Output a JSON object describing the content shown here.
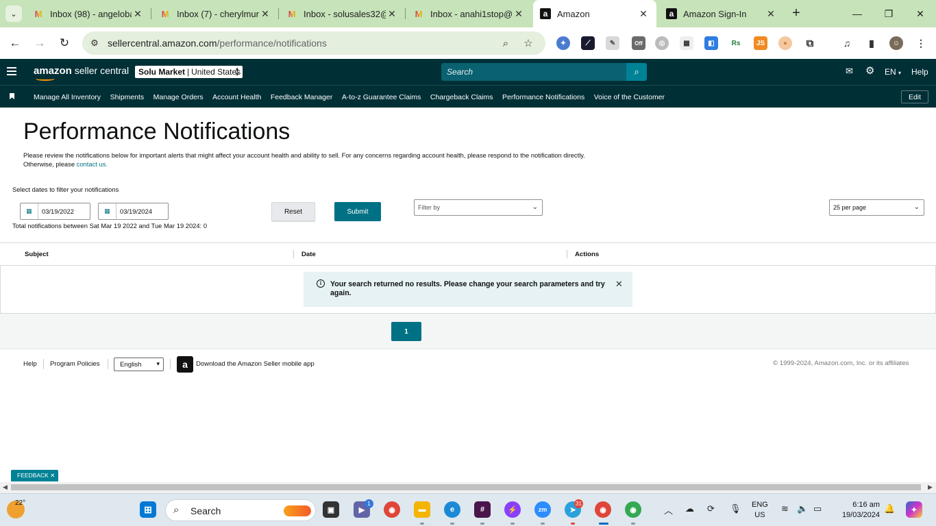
{
  "browser": {
    "tabs": [
      {
        "title": "Inbox (98) - angeloba",
        "icon": "gmail-icon"
      },
      {
        "title": "Inbox (7) - cherylmur",
        "icon": "gmail-icon"
      },
      {
        "title": "Inbox - solusales32@",
        "icon": "gmail-icon"
      },
      {
        "title": "Inbox - anahi1stop@",
        "icon": "gmail-icon"
      },
      {
        "title": "Amazon",
        "icon": "amazon-icon"
      },
      {
        "title": "Amazon Sign-In",
        "icon": "amazon-icon"
      }
    ],
    "url_host": "sellercentral.amazon.com",
    "url_path": "/performance/notifications",
    "extension_labels": {
      "off": "Off",
      "rs": "Rs",
      "js": "JS"
    }
  },
  "header": {
    "logo_bold": "amazon",
    "logo_rest": " seller central",
    "market_name": "Solu Market",
    "market_sep": "|",
    "market_country": "United States",
    "search_placeholder": "Search",
    "lang": "EN",
    "help": "Help"
  },
  "nav": {
    "items": [
      "Manage All Inventory",
      "Shipments",
      "Manage Orders",
      "Account Health",
      "Feedback Manager",
      "A-to-z Guarantee Claims",
      "Chargeback Claims",
      "Performance Notifications",
      "Voice of the Customer"
    ],
    "edit": "Edit"
  },
  "main": {
    "title": "Performance Notifications",
    "description": "Please review the notifications below for important alerts that might affect your account health and ability to sell. For any concerns regarding account health, please respond to the notification directly.",
    "otherwise": "Otherwise, please ",
    "contact_link": "contact us.",
    "filter_label": "Select dates to filter your notifications",
    "date_from": "03/19/2022",
    "date_to": "03/19/2024",
    "total_text": "Total notifications between Sat Mar 19 2022 and Tue Mar 19 2024: 0",
    "reset": "Reset",
    "submit": "Submit",
    "filter_by": "Filter by",
    "per_page": "25 per page",
    "columns": [
      "Subject",
      "Date",
      "Actions"
    ],
    "alert": "Your search returned no results. Please change your search parameters and try again.",
    "current_page": "1"
  },
  "footer": {
    "help": "Help",
    "policies": "Program Policies",
    "language": "English",
    "app_text": "Download the Amazon Seller mobile app",
    "copyright": "© 1999-2024, Amazon.com, Inc. or its affiliates"
  },
  "feedback": "FEEDBACK ✕",
  "taskbar": {
    "temp": "22°",
    "search": "Search",
    "teams_badge": "1",
    "telegram_badge": "31",
    "lang_line1": "ENG",
    "lang_line2": "US",
    "time": "6:16 am",
    "date": "19/03/2024"
  },
  "colors": {
    "header_bg": "#002f36",
    "accent": "#007185",
    "tabstrip": "#c7e3b9"
  }
}
